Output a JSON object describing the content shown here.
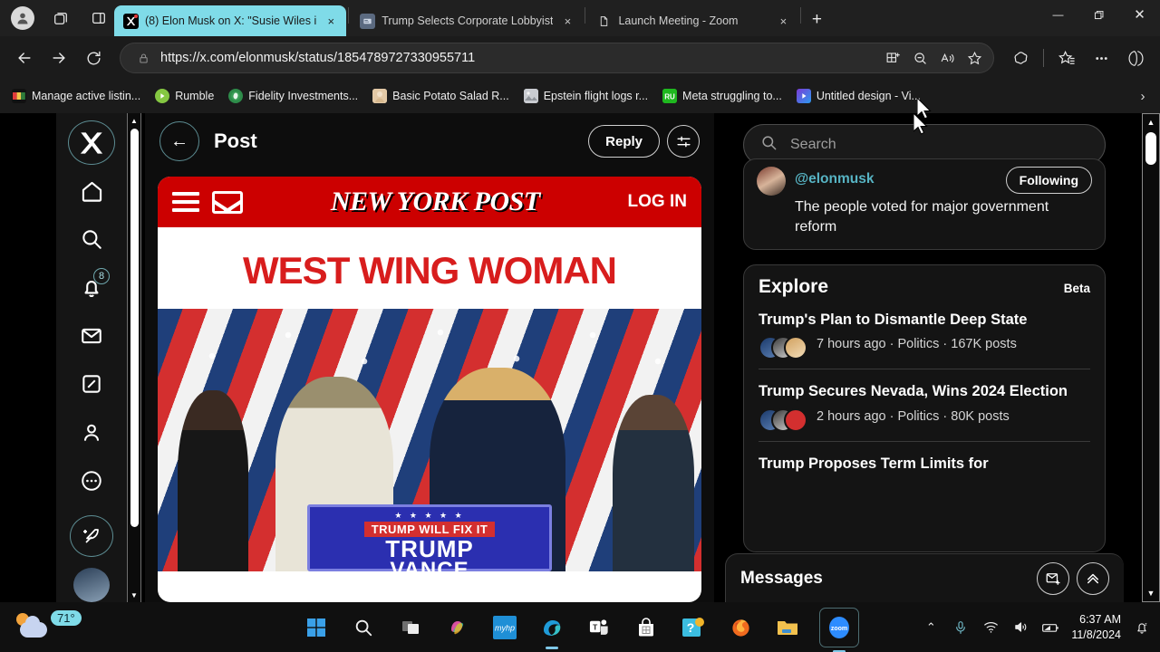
{
  "browser": {
    "tabs": [
      {
        "title": "(8) Elon Musk on X: \"Susie Wiles i",
        "favicon": "x-logo-icon",
        "active": true
      },
      {
        "title": "Trump Selects Corporate Lobbyist",
        "favicon": "news-icon",
        "active": false
      },
      {
        "title": "Launch Meeting - Zoom",
        "favicon": "document-icon",
        "active": false
      }
    ],
    "new_tab_label": "+",
    "close_label": "×",
    "window_controls": {
      "minimize": "—",
      "maximize": "❐",
      "close": "✕"
    },
    "url": "https://x.com/elonmusk/status/1854789727330955711",
    "nav": {
      "back": "←",
      "forward": "→",
      "reload": "⟳"
    },
    "bookmarks": [
      {
        "label": "Manage active listin...",
        "icon": "listing-icon"
      },
      {
        "label": "Rumble",
        "icon": "rumble-icon"
      },
      {
        "label": "Fidelity Investments...",
        "icon": "fidelity-icon"
      },
      {
        "label": "Basic Potato Salad R...",
        "icon": "recipe-icon"
      },
      {
        "label": "Epstein flight logs r...",
        "icon": "photo-icon"
      },
      {
        "label": "Meta struggling to...",
        "icon": "meta-news-icon"
      },
      {
        "label": "Untitled design - Vi...",
        "icon": "design-icon"
      }
    ],
    "bookmarks_overflow": "›"
  },
  "x_app": {
    "rail": [
      {
        "name": "x-logo",
        "glyph": "X"
      },
      {
        "name": "home",
        "glyph": "⌂"
      },
      {
        "name": "search",
        "glyph": "⚲"
      },
      {
        "name": "notifications",
        "glyph": "🔔",
        "badge": "8"
      },
      {
        "name": "messages",
        "glyph": "✉"
      },
      {
        "name": "grok",
        "glyph": "∕"
      },
      {
        "name": "profile",
        "glyph": "☺"
      },
      {
        "name": "more",
        "glyph": "⋯"
      }
    ],
    "compose_label": "compose-post",
    "post": {
      "header_title": "Post",
      "back_label": "←",
      "reply_button": "Reply",
      "settings_icon": "sliders-icon"
    },
    "article": {
      "site_name": "NEW YORK POST",
      "login_label": "LOG IN",
      "headline": "WEST WING WOMAN",
      "podium": {
        "stars": "★ ★ ★ ★ ★",
        "slogan": "TRUMP WILL FIX IT",
        "line1": "TRUMP",
        "line2": "VANCE"
      }
    },
    "search": {
      "placeholder": "Search",
      "icon": "search-icon"
    },
    "tweet_preview": {
      "handle": "@elonmusk",
      "follow_state": "Following",
      "text": "The people voted for major government reform"
    },
    "explore": {
      "title": "Explore",
      "badge": "Beta",
      "trends": [
        {
          "title": "Trump's Plan to Dismantle Deep State",
          "meta": "7 hours ago · Politics · 167K posts"
        },
        {
          "title": "Trump Secures Nevada, Wins 2024 Election",
          "meta": "2 hours ago · Politics · 80K posts"
        },
        {
          "title": "Trump Proposes Term Limits for",
          "meta": ""
        }
      ]
    },
    "messages": {
      "title": "Messages",
      "new_message_icon": "new-message-icon",
      "expand_icon": "chevron-up-icon"
    }
  },
  "taskbar": {
    "weather": {
      "temp": "71°",
      "icon": "partly-cloudy-icon"
    },
    "apps": [
      {
        "name": "start",
        "label": "Start"
      },
      {
        "name": "search",
        "label": "Search"
      },
      {
        "name": "task-view",
        "label": "Task View"
      },
      {
        "name": "copilot",
        "label": "Copilot"
      },
      {
        "name": "myhp",
        "label": "myHP"
      },
      {
        "name": "edge",
        "label": "Microsoft Edge",
        "active": true
      },
      {
        "name": "teams",
        "label": "Microsoft Teams"
      },
      {
        "name": "store",
        "label": "Microsoft Store"
      },
      {
        "name": "help",
        "label": "Get Help"
      },
      {
        "name": "firefox",
        "label": "Firefox"
      },
      {
        "name": "file-explorer",
        "label": "File Explorer"
      },
      {
        "name": "zoom",
        "label": "zoom",
        "active": true
      }
    ],
    "tray": {
      "overflow": "⌃",
      "mic": "microphone-icon",
      "wifi": "wifi-icon",
      "volume": "volume-icon",
      "battery": "battery-icon",
      "time": "6:37 AM",
      "date": "11/8/2024",
      "notifications": "notification-bell-icon"
    }
  },
  "colors": {
    "tab_active": "#7fdbe8",
    "nyp_red": "#cc0000",
    "headline_red": "#d81d1d",
    "x_accent": "#57b4c4",
    "podium_blue": "#2b2fb0"
  }
}
